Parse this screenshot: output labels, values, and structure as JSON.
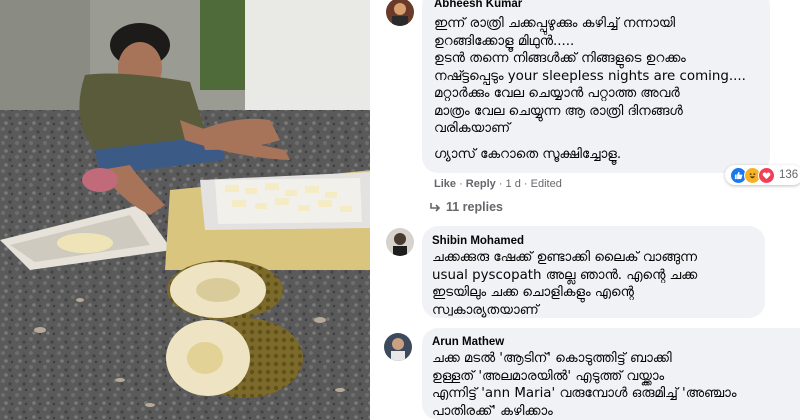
{
  "comments": [
    {
      "author": "Abheesh Kumar",
      "lines": [
        "ഇന്ന് രാത്രി ചക്കപ്പുഴുക്കും കഴിച്ച് നന്നായി",
        "ഉറങ്ങിക്കോളൂ മിഥുൻ.....",
        "ഉടൻ തന്നെ നിങ്ങൾക്ക് നിങ്ങളുടെ ഉറക്കം",
        "നഷ്ട്ടപ്പെടും your sleepless nights are coming....",
        "മറ്റാർക്കും വേല ചെയ്യാൻ പറ്റാത്ത അവർ",
        "മാത്രം വേല ചെയ്യുന്ന ആ രാത്രി ദിനങ്ങൾ",
        "വരികയാണ്",
        "",
        "ഗ്യാസ് കേറാതെ സൂക്ഷിച്ചോളൂ."
      ],
      "actions": {
        "like": "Like",
        "reply": "Reply",
        "time": "1 d",
        "edited": "Edited"
      },
      "reactions_count": "136",
      "replies": "11 replies"
    },
    {
      "author": "Shibin Mohamed",
      "lines": [
        "ചക്കക്കുരു ഷേക്ക് ഉണ്ടാക്കി ലൈക് വാങ്ങുന്ന",
        "usual pyscopath അല്ല ഞാൻ. എന്റെ ചക്ക",
        "ഇടയിലും ചക്ക ചൊളികളും എന്റെ",
        "സ്വകാര്യതയാണ്"
      ]
    },
    {
      "author": "Arun Mathew",
      "lines": [
        "ചക്ക മടൽ 'ആടിന്' കൊടുത്തിട്ട് ബാക്കി",
        "ഉള്ളത് 'അലമാരയിൽ' എടുത്ത് വയ്ക്കാം",
        "എന്നിട്ട് 'ann Maria' വരുമ്പോൾ ഒരുമിച്ച് 'അഞ്ചാം",
        "പാതിരക്ക്' കഴിക്കാം"
      ]
    }
  ]
}
